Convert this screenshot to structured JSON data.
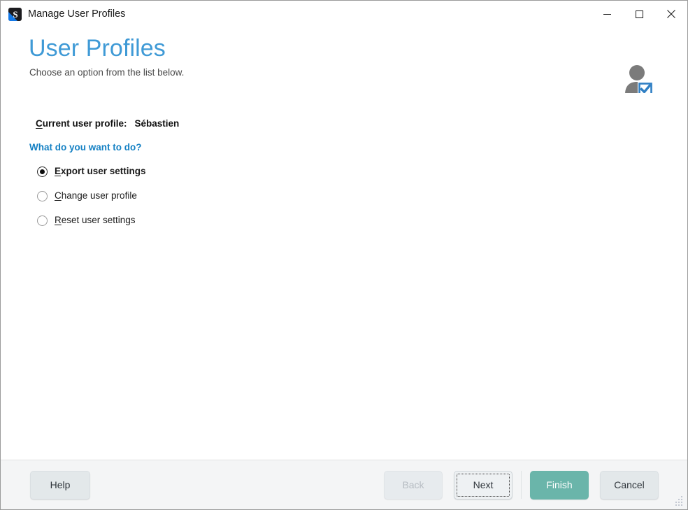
{
  "window": {
    "title": "Manage User Profiles",
    "app_icon": "app-logo-icon",
    "controls": {
      "minimize": "minimize-button",
      "maximize": "maximize-button",
      "close": "close-button"
    }
  },
  "header": {
    "title": "User Profiles",
    "subtitle": "Choose an option from the list below.",
    "title_color": "#3f9ad6",
    "badge_icon": "user-verified-icon"
  },
  "content": {
    "current_profile_label": "Current user profile:",
    "current_profile_accelerator": "C",
    "current_profile_label_rest": "urrent user profile:",
    "current_profile_value": "Sébastien",
    "question": "What do you want to do?",
    "question_color": "#1581c4",
    "options": [
      {
        "accelerator": "E",
        "rest": "xport user settings",
        "label": "Export user settings",
        "selected": true
      },
      {
        "accelerator": "C",
        "rest": "hange user profile",
        "label": "Change user profile",
        "selected": false
      },
      {
        "accelerator": "R",
        "rest": "eset user settings",
        "label": "Reset user settings",
        "selected": false
      }
    ]
  },
  "footer": {
    "help_label": "Help",
    "back_label": "Back",
    "back_disabled": true,
    "next_label": "Next",
    "next_focused": true,
    "finish_label": "Finish",
    "finish_color": "#6ab5aa",
    "cancel_label": "Cancel",
    "resize_grip": "resize-grip-icon"
  }
}
